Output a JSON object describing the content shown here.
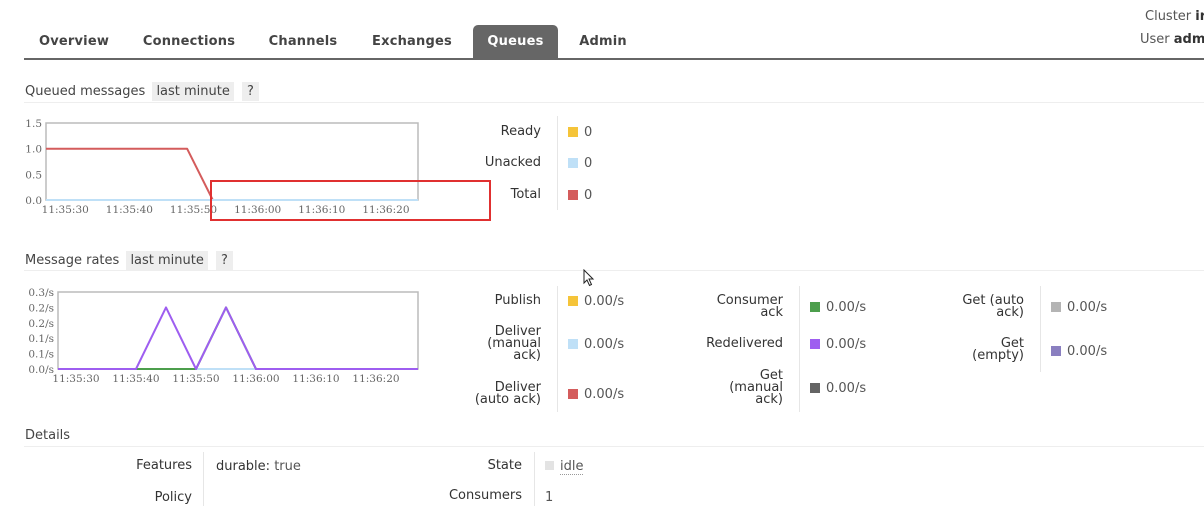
{
  "header": {
    "cluster_label": "Cluster",
    "cluster_value": "ir",
    "user_label": "User",
    "user_value": "adm",
    "tabs": [
      {
        "label": "Overview",
        "active": false
      },
      {
        "label": "Connections",
        "active": false
      },
      {
        "label": "Channels",
        "active": false
      },
      {
        "label": "Exchanges",
        "active": false
      },
      {
        "label": "Queues",
        "active": true
      },
      {
        "label": "Admin",
        "active": false
      }
    ]
  },
  "queued": {
    "title": "Queued messages",
    "range": "last minute",
    "help": "?",
    "legend": [
      {
        "label": "Ready",
        "value": "0",
        "color": "#f5c439"
      },
      {
        "label": "Unacked",
        "value": "0",
        "color": "#bfe0f7"
      },
      {
        "label": "Total",
        "value": "0",
        "color": "#d45c5c"
      }
    ]
  },
  "rates": {
    "title": "Message rates",
    "range": "last minute",
    "help": "?",
    "col1": [
      {
        "label": "Publish",
        "value": "0.00/s",
        "color": "#f5c439"
      },
      {
        "label": "Deliver (manual ack)",
        "lines": [
          "Deliver",
          "(manual",
          "ack)"
        ],
        "value": "0.00/s",
        "color": "#bfe0f7"
      },
      {
        "label": "Deliver (auto ack)",
        "lines": [
          "Deliver",
          "(auto ack)"
        ],
        "value": "0.00/s",
        "color": "#d45c5c"
      }
    ],
    "col2": [
      {
        "label": "Consumer ack",
        "lines": [
          "Consumer",
          "ack"
        ],
        "value": "0.00/s",
        "color": "#4c9e4c"
      },
      {
        "label": "Redelivered",
        "lines": [
          "Redelivered"
        ],
        "value": "0.00/s",
        "color": "#9e5ef0"
      },
      {
        "label": "Get (manual ack)",
        "lines": [
          "Get",
          "(manual",
          "ack)"
        ],
        "value": "0.00/s",
        "color": "#646464"
      }
    ],
    "col3": [
      {
        "label": "Get (auto ack)",
        "lines": [
          "Get (auto",
          "ack)"
        ],
        "value": "0.00/s",
        "color": "#b4b4b4"
      },
      {
        "label": "Get (empty)",
        "lines": [
          "Get",
          "(empty)"
        ],
        "value": "0.00/s",
        "color": "#8a7fc0"
      }
    ]
  },
  "details": {
    "title": "Details",
    "features_label": "Features",
    "features_key": "durable:",
    "features_value": "true",
    "policy_label": "Policy",
    "policy_value": "",
    "state_label": "State",
    "state_value": "idle",
    "consumers_label": "Consumers",
    "consumers_value": "1"
  },
  "chart_data": [
    {
      "type": "line",
      "title": "Queued messages",
      "x": [
        "11:35:30",
        "11:35:40",
        "11:35:50",
        "11:36:00",
        "11:36:10",
        "11:36:20"
      ],
      "xticks": [
        "11:35:30",
        "11:35:40",
        "11:35:50",
        "11:36:00",
        "11:36:10",
        "11:36:20"
      ],
      "yticks": [
        "0.0",
        "0.5",
        "1.0",
        "1.5"
      ],
      "ylim": [
        0,
        1.5
      ],
      "xlim": [
        "11:35:27",
        "11:36:25"
      ],
      "series": [
        {
          "name": "Total",
          "color": "#d45c5c",
          "points": [
            [
              "11:35:27",
              1.0
            ],
            [
              "11:35:49",
              1.0
            ],
            [
              "11:35:53",
              0.0
            ],
            [
              "11:36:25",
              0.0
            ]
          ]
        },
        {
          "name": "Unacked",
          "color": "#bfe0f7",
          "points": [
            [
              "11:35:27",
              0.0
            ],
            [
              "11:36:25",
              0.0
            ]
          ]
        }
      ]
    },
    {
      "type": "line",
      "title": "Message rates",
      "xticks": [
        "11:35:30",
        "11:35:40",
        "11:35:50",
        "11:36:00",
        "11:36:10",
        "11:36:20"
      ],
      "yticks": [
        "0.0/s",
        "0.1/s",
        "0.1/s",
        "0.2/s",
        "0.2/s",
        "0.3/s"
      ],
      "ylim": [
        0,
        0.25
      ],
      "xlim": [
        "11:35:27",
        "11:36:27"
      ],
      "series": [
        {
          "name": "Deliver (manual ack)",
          "color": "#bfe0f7",
          "points": [
            [
              "11:35:27",
              0
            ],
            [
              "11:36:27",
              0
            ]
          ]
        },
        {
          "name": "Consumer ack",
          "color": "#4c9e4c",
          "points": [
            [
              "11:35:27",
              0
            ],
            [
              "11:35:50",
              0
            ],
            [
              "11:35:55",
              0.2
            ],
            [
              "11:36:00",
              0
            ],
            [
              "11:36:27",
              0
            ]
          ]
        },
        {
          "name": "Redelivered",
          "color": "#9e5ef0",
          "points": [
            [
              "11:35:27",
              0
            ],
            [
              "11:35:40",
              0
            ],
            [
              "11:35:45",
              0.2
            ],
            [
              "11:35:50",
              0
            ],
            [
              "11:35:55",
              0.2
            ],
            [
              "11:36:00",
              0
            ],
            [
              "11:36:27",
              0
            ]
          ]
        }
      ]
    }
  ]
}
